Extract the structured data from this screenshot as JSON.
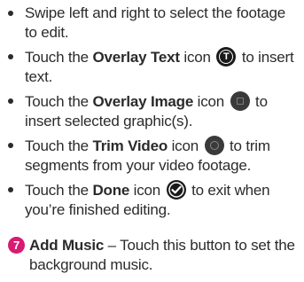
{
  "bullets": [
    {
      "pre": "Swipe left and right to select the footage to edit."
    },
    {
      "pre": "Touch the ",
      "bold": "Overlay Text",
      "mid": " icon ",
      "icon": "overlay-text-icon",
      "post": " to insert text."
    },
    {
      "pre": "Touch the ",
      "bold": "Overlay Image",
      "mid": " icon ",
      "icon": "overlay-image-icon",
      "post": " to insert selected graphic(s)."
    },
    {
      "pre": "Touch the ",
      "bold": "Trim Video",
      "mid": " icon ",
      "icon": "trim-video-icon",
      "post": " to trim segments from your video footage."
    },
    {
      "pre": "Touch the ",
      "bold": "Done",
      "mid": " icon ",
      "icon": "done-check-icon",
      "post": " to exit when you’re finished editing."
    }
  ],
  "numbered": {
    "number": "7",
    "badge_color": "#d81b72",
    "title": "Add Music",
    "text": " – Touch this button to set the background music."
  }
}
